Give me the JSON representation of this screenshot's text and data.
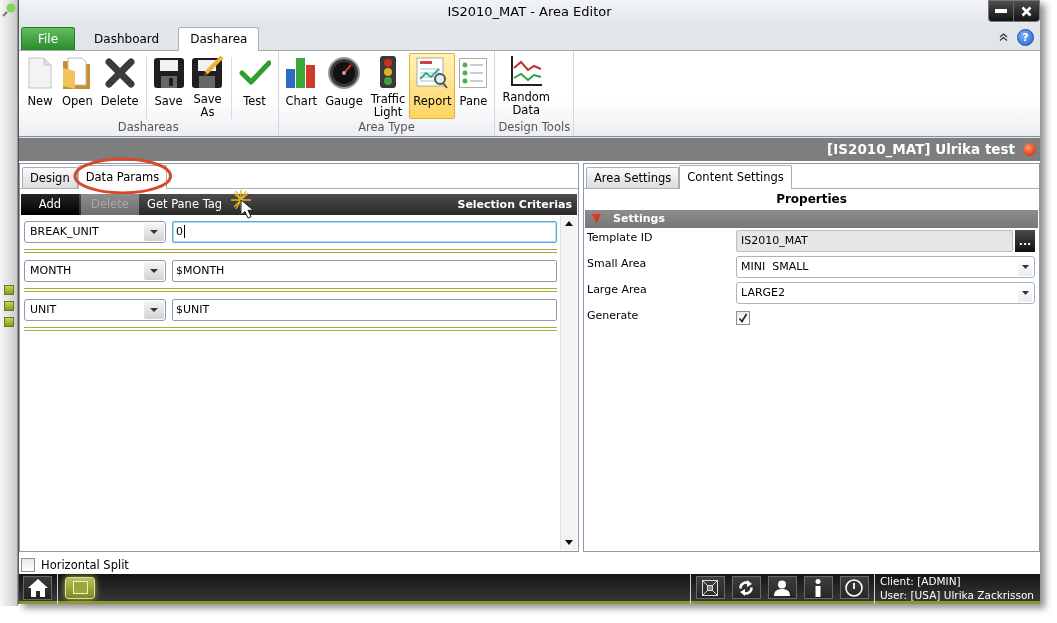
{
  "window": {
    "title": "IS2010_MAT - Area Editor",
    "help_button": "?"
  },
  "ribbon_tabs": [
    {
      "label": "File",
      "kind": "file",
      "selected": false
    },
    {
      "label": "Dashboard",
      "kind": "tab",
      "selected": false
    },
    {
      "label": "Dasharea",
      "kind": "tab",
      "selected": true
    }
  ],
  "ribbon_groups": [
    {
      "label": "Dashareas",
      "sets": [
        [
          {
            "label": "New"
          },
          {
            "label": "Open"
          },
          {
            "label": "Delete"
          }
        ],
        [
          {
            "label": "Save"
          },
          {
            "label": "Save As"
          }
        ],
        [
          {
            "label": "Test"
          }
        ]
      ]
    },
    {
      "label": "Area Type",
      "sets": [
        [
          {
            "label": "Chart",
            "selected": false
          },
          {
            "label": "Gauge",
            "selected": false
          },
          {
            "label": "Traffic Light",
            "selected": false
          },
          {
            "label": "Report",
            "selected": true
          },
          {
            "label": "Pane",
            "selected": false
          }
        ]
      ]
    },
    {
      "label": "Design Tools",
      "sets": [
        [
          {
            "label": "Random Data"
          }
        ]
      ]
    }
  ],
  "area_header": {
    "title": "[IS2010_MAT] Ulrika test"
  },
  "left_panel": {
    "tabs": [
      {
        "label": "Design",
        "selected": false
      },
      {
        "label": "Data Params",
        "selected": true
      }
    ],
    "toolbar": {
      "buttons": [
        {
          "label": "Add",
          "disabled": false
        },
        {
          "label": "Delete",
          "disabled": true
        },
        {
          "label": "Get Pane Tag",
          "disabled": false
        }
      ],
      "title": "Selection Criterias"
    },
    "criteria": [
      {
        "field": "BREAK_UNIT",
        "value": "0",
        "focused": true
      },
      {
        "field": "MONTH",
        "value": "$MONTH",
        "focused": false
      },
      {
        "field": "UNIT",
        "value": "$UNIT",
        "focused": false
      }
    ]
  },
  "right_panel": {
    "tabs": [
      {
        "label": "Area Settings",
        "selected": false
      },
      {
        "label": "Content Settings",
        "selected": true
      }
    ],
    "title": "Properties",
    "settings": {
      "label": "Settings",
      "expanded": true,
      "rows": [
        {
          "kind": "readonly",
          "label": "Template ID",
          "value": "IS2010_MAT",
          "button": "..."
        },
        {
          "kind": "select",
          "label": "Small Area",
          "value": "MINI  SMALL"
        },
        {
          "kind": "select",
          "label": "Large Area",
          "value": "LARGE2"
        },
        {
          "kind": "checkbox",
          "label": "Generate",
          "checked": true
        }
      ]
    }
  },
  "horizontal_split": {
    "label": "Horizontal Split",
    "checked": false
  },
  "status": {
    "client": "Client: [ADMIN]",
    "user": "User: [USA] Ulrika Zackrisson"
  }
}
